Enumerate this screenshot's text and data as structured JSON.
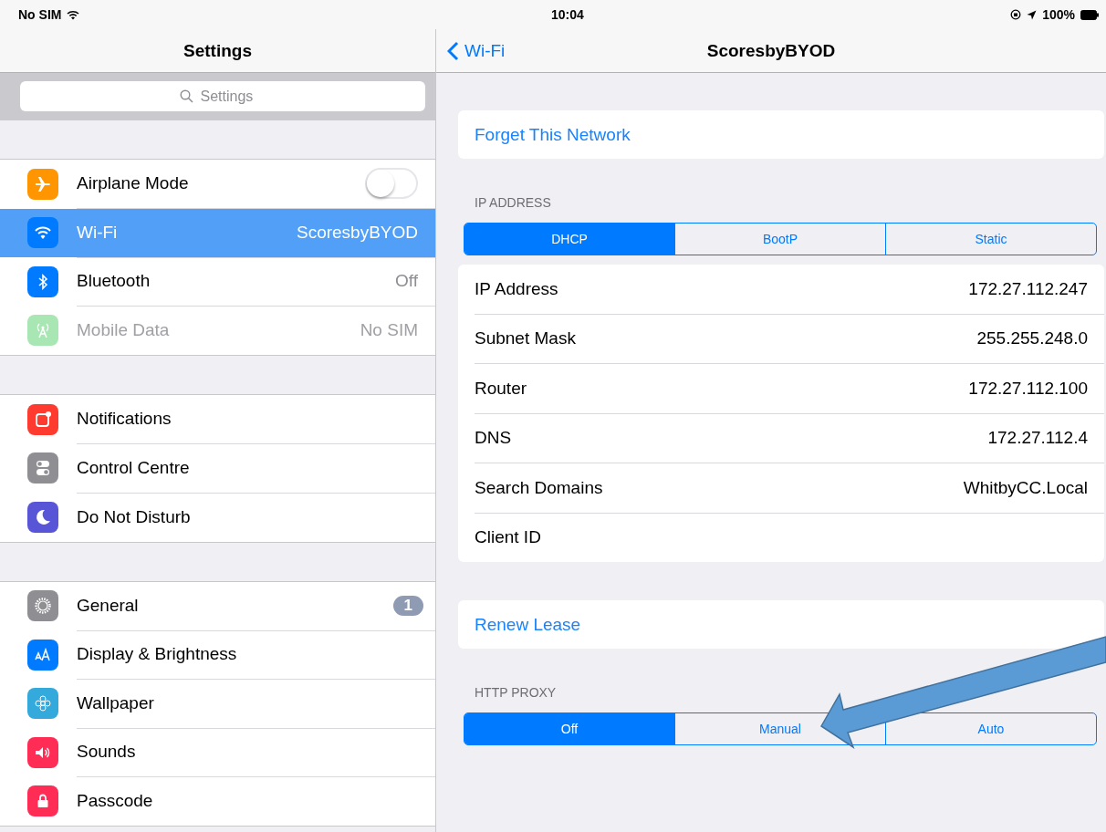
{
  "status_bar": {
    "carrier": "No SIM",
    "time": "10:04",
    "battery": "100%"
  },
  "sidebar": {
    "title": "Settings",
    "search": {
      "placeholder": "Settings"
    },
    "groups": [
      [
        {
          "label": "Airplane Mode",
          "kind": "toggle",
          "on": false,
          "selected": false,
          "disabled": false,
          "color": "#ff9500"
        },
        {
          "label": "Wi-Fi",
          "value": "ScoresbyBYOD",
          "kind": "detail",
          "selected": true,
          "disabled": false,
          "color": "#007aff"
        },
        {
          "label": "Bluetooth",
          "value": "Off",
          "kind": "detail",
          "selected": false,
          "disabled": false,
          "color": "#007aff"
        },
        {
          "label": "Mobile Data",
          "value": "No SIM",
          "kind": "detail",
          "selected": false,
          "disabled": true,
          "color": "#a8e6b4"
        }
      ],
      [
        {
          "label": "Notifications",
          "kind": "plain",
          "selected": false,
          "disabled": false,
          "color": "#ff3b30"
        },
        {
          "label": "Control Centre",
          "kind": "plain",
          "selected": false,
          "disabled": false,
          "color": "#8e8e93"
        },
        {
          "label": "Do Not Disturb",
          "kind": "plain",
          "selected": false,
          "disabled": false,
          "color": "#5856d6"
        }
      ],
      [
        {
          "label": "General",
          "kind": "badge",
          "badge": "1",
          "selected": false,
          "disabled": false,
          "color": "#8e8e93"
        },
        {
          "label": "Display & Brightness",
          "kind": "plain",
          "selected": false,
          "disabled": false,
          "color": "#007aff"
        },
        {
          "label": "Wallpaper",
          "kind": "plain",
          "selected": false,
          "disabled": false,
          "color": "#34aadc"
        },
        {
          "label": "Sounds",
          "kind": "plain",
          "selected": false,
          "disabled": false,
          "color": "#ff2d55"
        },
        {
          "label": "Passcode",
          "kind": "plain",
          "selected": false,
          "disabled": false,
          "color": "#ff2d55"
        }
      ]
    ]
  },
  "detail": {
    "back": "Wi-Fi",
    "title": "ScoresbyBYOD",
    "forget": "Forget This Network",
    "ip_header": "IP ADDRESS",
    "ip_mode": [
      {
        "label": "DHCP",
        "selected": true
      },
      {
        "label": "BootP",
        "selected": false
      },
      {
        "label": "Static",
        "selected": false
      }
    ],
    "fields": [
      {
        "label": "IP Address",
        "value": "172.27.112.247"
      },
      {
        "label": "Subnet Mask",
        "value": "255.255.248.0"
      },
      {
        "label": "Router",
        "value": "172.27.112.100"
      },
      {
        "label": "DNS",
        "value": "172.27.112.4"
      },
      {
        "label": "Search Domains",
        "value": "WhitbyCC.Local"
      },
      {
        "label": "Client ID"
      }
    ],
    "renew": "Renew Lease",
    "proxy_header": "HTTP PROXY",
    "proxy_mode": [
      {
        "label": "Off",
        "selected": true
      },
      {
        "label": "Manual",
        "selected": false
      },
      {
        "label": "Auto",
        "selected": false
      }
    ]
  }
}
